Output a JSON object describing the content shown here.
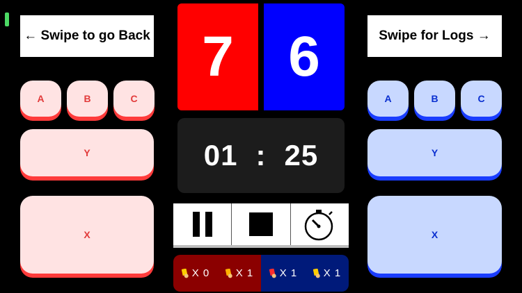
{
  "nav": {
    "back_label": "← Swipe to go Back",
    "logs_label": "Swipe for Logs →"
  },
  "scores": {
    "red": "7",
    "blue": "6"
  },
  "timer": {
    "minutes": "01",
    "separator": ":",
    "seconds": "25"
  },
  "red_panel": {
    "keys": [
      "A",
      "B",
      "C"
    ],
    "y_label": "Y",
    "x_label": "X"
  },
  "blue_panel": {
    "keys": [
      "A",
      "B",
      "C"
    ],
    "y_label": "Y",
    "x_label": "X"
  },
  "cards": {
    "red_team": {
      "yellow_count": "X 0",
      "orange_count": "X 1"
    },
    "blue_team": {
      "red_count": "X 1",
      "yellow_count": "X 1"
    }
  },
  "colors": {
    "red_team": "#ff0000",
    "blue_team": "#0000ff",
    "red_cards_bg": "#8b0000",
    "blue_cards_bg": "#001a7a"
  },
  "icons": [
    "pause-icon",
    "stop-icon",
    "stopwatch-icon",
    "penalty-card-icon"
  ]
}
